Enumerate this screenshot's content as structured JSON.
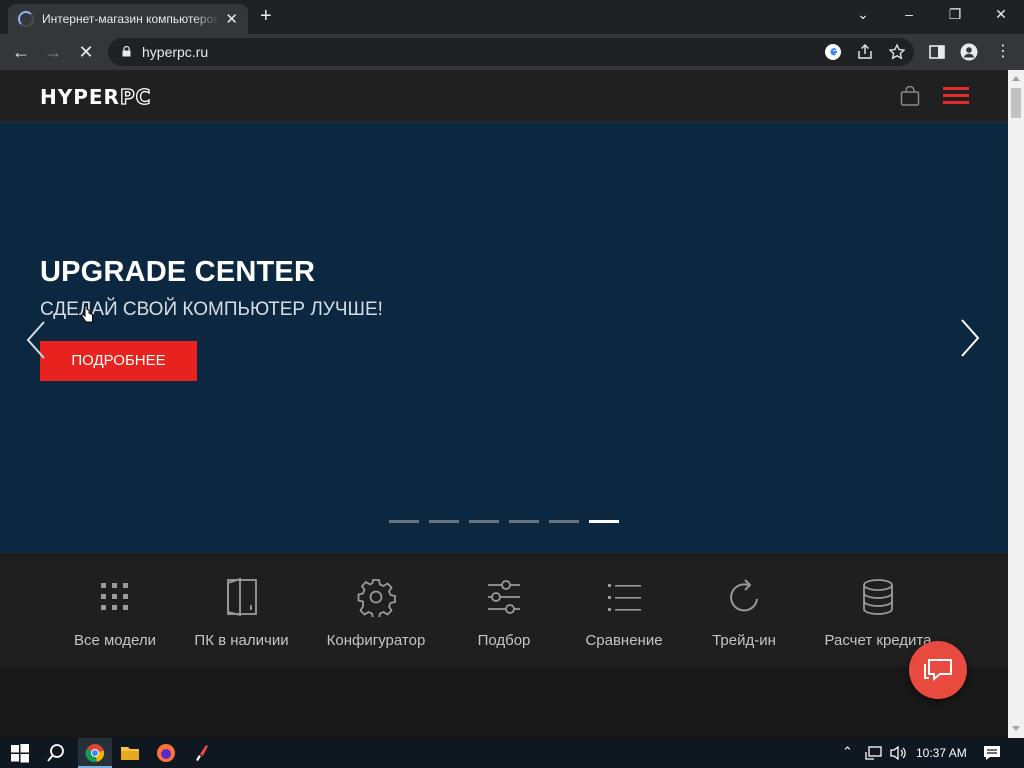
{
  "browser": {
    "tab_title": "Интернет-магазин компьютеров HYPERPC",
    "url": "hyperpc.ru"
  },
  "site": {
    "logo_prefix": "HYPER",
    "logo_suffix": "PC"
  },
  "hero": {
    "title": "UPGRADE CENTER",
    "subtitle": "СДЕЛАЙ СВОЙ КОМПЬЮТЕР ЛУЧШЕ!",
    "button": "ПОДРОБНЕЕ",
    "slides_total": 6,
    "active_slide": 6
  },
  "categories": [
    {
      "label": "Все модели",
      "icon": "grid-icon"
    },
    {
      "label": "ПК в наличии",
      "icon": "pc-case-icon"
    },
    {
      "label": "Конфигуратор",
      "icon": "gear-icon"
    },
    {
      "label": "Подбор",
      "icon": "sliders-icon"
    },
    {
      "label": "Сравнение",
      "icon": "list-icon"
    },
    {
      "label": "Трейд-ин",
      "icon": "refresh-icon"
    },
    {
      "label": "Расчет кредита",
      "icon": "coins-icon"
    }
  ],
  "taskbar": {
    "clock": "10:37 AM"
  },
  "colors": {
    "accent_red": "#e8231f",
    "hero_bg": "#0c2840",
    "chat_bg": "#e84a3f"
  }
}
